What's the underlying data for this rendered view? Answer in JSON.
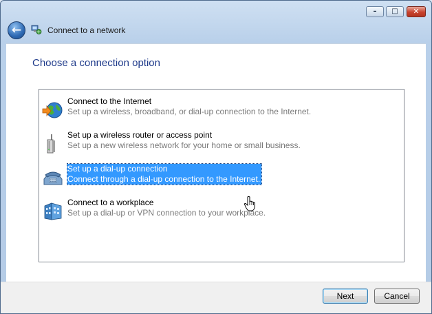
{
  "window": {
    "title": "Connect to a network",
    "caption_buttons": {
      "minimize": "–",
      "maximize": "□",
      "close": "✕"
    }
  },
  "nav": {
    "back_icon": "back-arrow-icon",
    "back_glyph": "←"
  },
  "heading": "Choose a connection option",
  "options": [
    {
      "title": "Connect to the Internet",
      "description": "Set up a wireless, broadband, or dial-up connection to the Internet.",
      "icon": "internet-globe-icon",
      "selected": false
    },
    {
      "title": "Set up a wireless router or access point",
      "description": "Set up a new wireless network for your home or small business.",
      "icon": "wireless-router-icon",
      "selected": false
    },
    {
      "title": "Set up a dial-up connection",
      "description": "Connect through a dial-up connection to the Internet.",
      "icon": "dialup-phone-icon",
      "selected": true
    },
    {
      "title": "Connect to a workplace",
      "description": "Set up a dial-up or VPN connection to your workplace.",
      "icon": "workplace-icon",
      "selected": false
    }
  ],
  "buttons": {
    "next": "Next",
    "cancel": "Cancel"
  },
  "colors": {
    "selection": "#3399ff",
    "heading": "#1e3a8a",
    "description": "#7a7a7a"
  }
}
